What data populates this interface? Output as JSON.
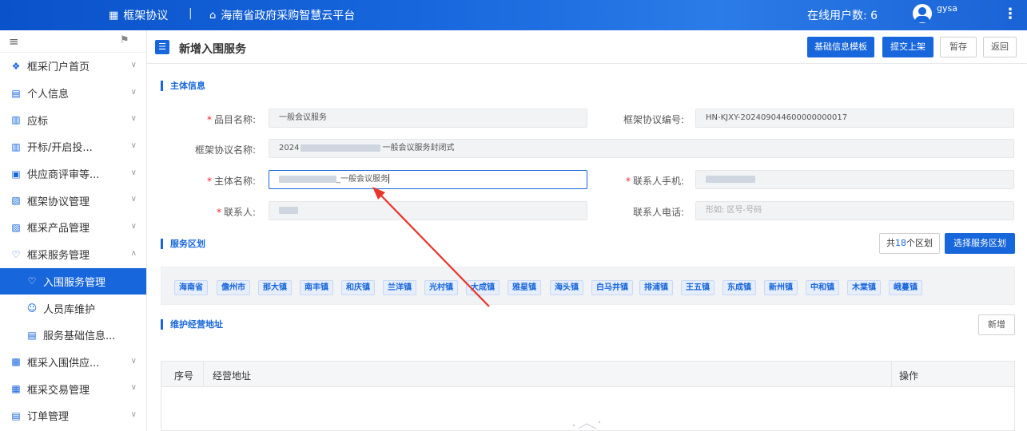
{
  "topbar": {
    "left_title": "框架协议",
    "separator": "|",
    "site_title": "海南省政府采购智慧云平台",
    "online_users": "在线用户数: 6",
    "username": "gysa"
  },
  "sidebar": {
    "items": [
      {
        "label": "框采门户首页",
        "icon": "grid-icon"
      },
      {
        "label": "个人信息",
        "icon": "id-card-icon"
      },
      {
        "label": "应标",
        "icon": "document-icon"
      },
      {
        "label": "开标/开启投...",
        "icon": "document-icon"
      },
      {
        "label": "供应商评审等...",
        "icon": "monitor-icon"
      },
      {
        "label": "框架协议管理",
        "icon": "contract-icon"
      },
      {
        "label": "框采产品管理",
        "icon": "product-icon"
      },
      {
        "label": "框采服务管理",
        "icon": "service-icon"
      },
      {
        "label": "入围服务管理",
        "icon": "service-icon"
      },
      {
        "label": "人员库维护",
        "icon": "user-icon"
      },
      {
        "label": "服务基础信息...",
        "icon": "id-card-icon"
      },
      {
        "label": "框采入围供应...",
        "icon": "supplier-icon"
      },
      {
        "label": "框采交易管理",
        "icon": "trade-icon"
      },
      {
        "label": "订单管理",
        "icon": "order-icon"
      }
    ]
  },
  "page": {
    "title": "新增入围服务",
    "buttons": {
      "template": "基础信息模板",
      "submit": "提交上架",
      "save_draft": "暂存",
      "back": "返回"
    }
  },
  "main_info": {
    "section_title": "主体信息",
    "item_name_label": "品目名称:",
    "item_name_value": "一般会议服务",
    "agreement_no_label": "框架协议编号:",
    "agreement_no_value": "HN-KJXY-202409044600000000017",
    "agreement_name_label": "框架协议名称:",
    "agreement_name_prefix": "2024",
    "agreement_name_suffix": "一般会议服务封闭式",
    "subject_name_label": "主体名称:",
    "subject_name_suffix": "_一般会议服务",
    "contact_mobile_label": "联系人手机:",
    "contact_label": "联系人:",
    "contact_phone_label": "联系人电话:",
    "contact_phone_placeholder": "形如: 区号-号码",
    "required_mark": "*"
  },
  "service_area": {
    "section_title": "服务区划",
    "count_prefix": "共",
    "count": "18",
    "count_suffix": "个区划",
    "select_button": "选择服务区划",
    "areas": [
      "海南省",
      "儋州市",
      "那大镇",
      "南丰镇",
      "和庆镇",
      "兰洋镇",
      "光村镇",
      "大成镇",
      "雅星镇",
      "海头镇",
      "白马井镇",
      "排浦镇",
      "王五镇",
      "东成镇",
      "新州镇",
      "中和镇",
      "木棠镇",
      "峨蔓镇"
    ]
  },
  "address": {
    "section_title": "维护经营地址",
    "add_button": "新增",
    "columns": [
      "序号",
      "经营地址",
      "操作"
    ]
  },
  "colors": {
    "primary": "#1766dc",
    "required": "#f5222d",
    "annotation_arrow": "#e8362c"
  }
}
